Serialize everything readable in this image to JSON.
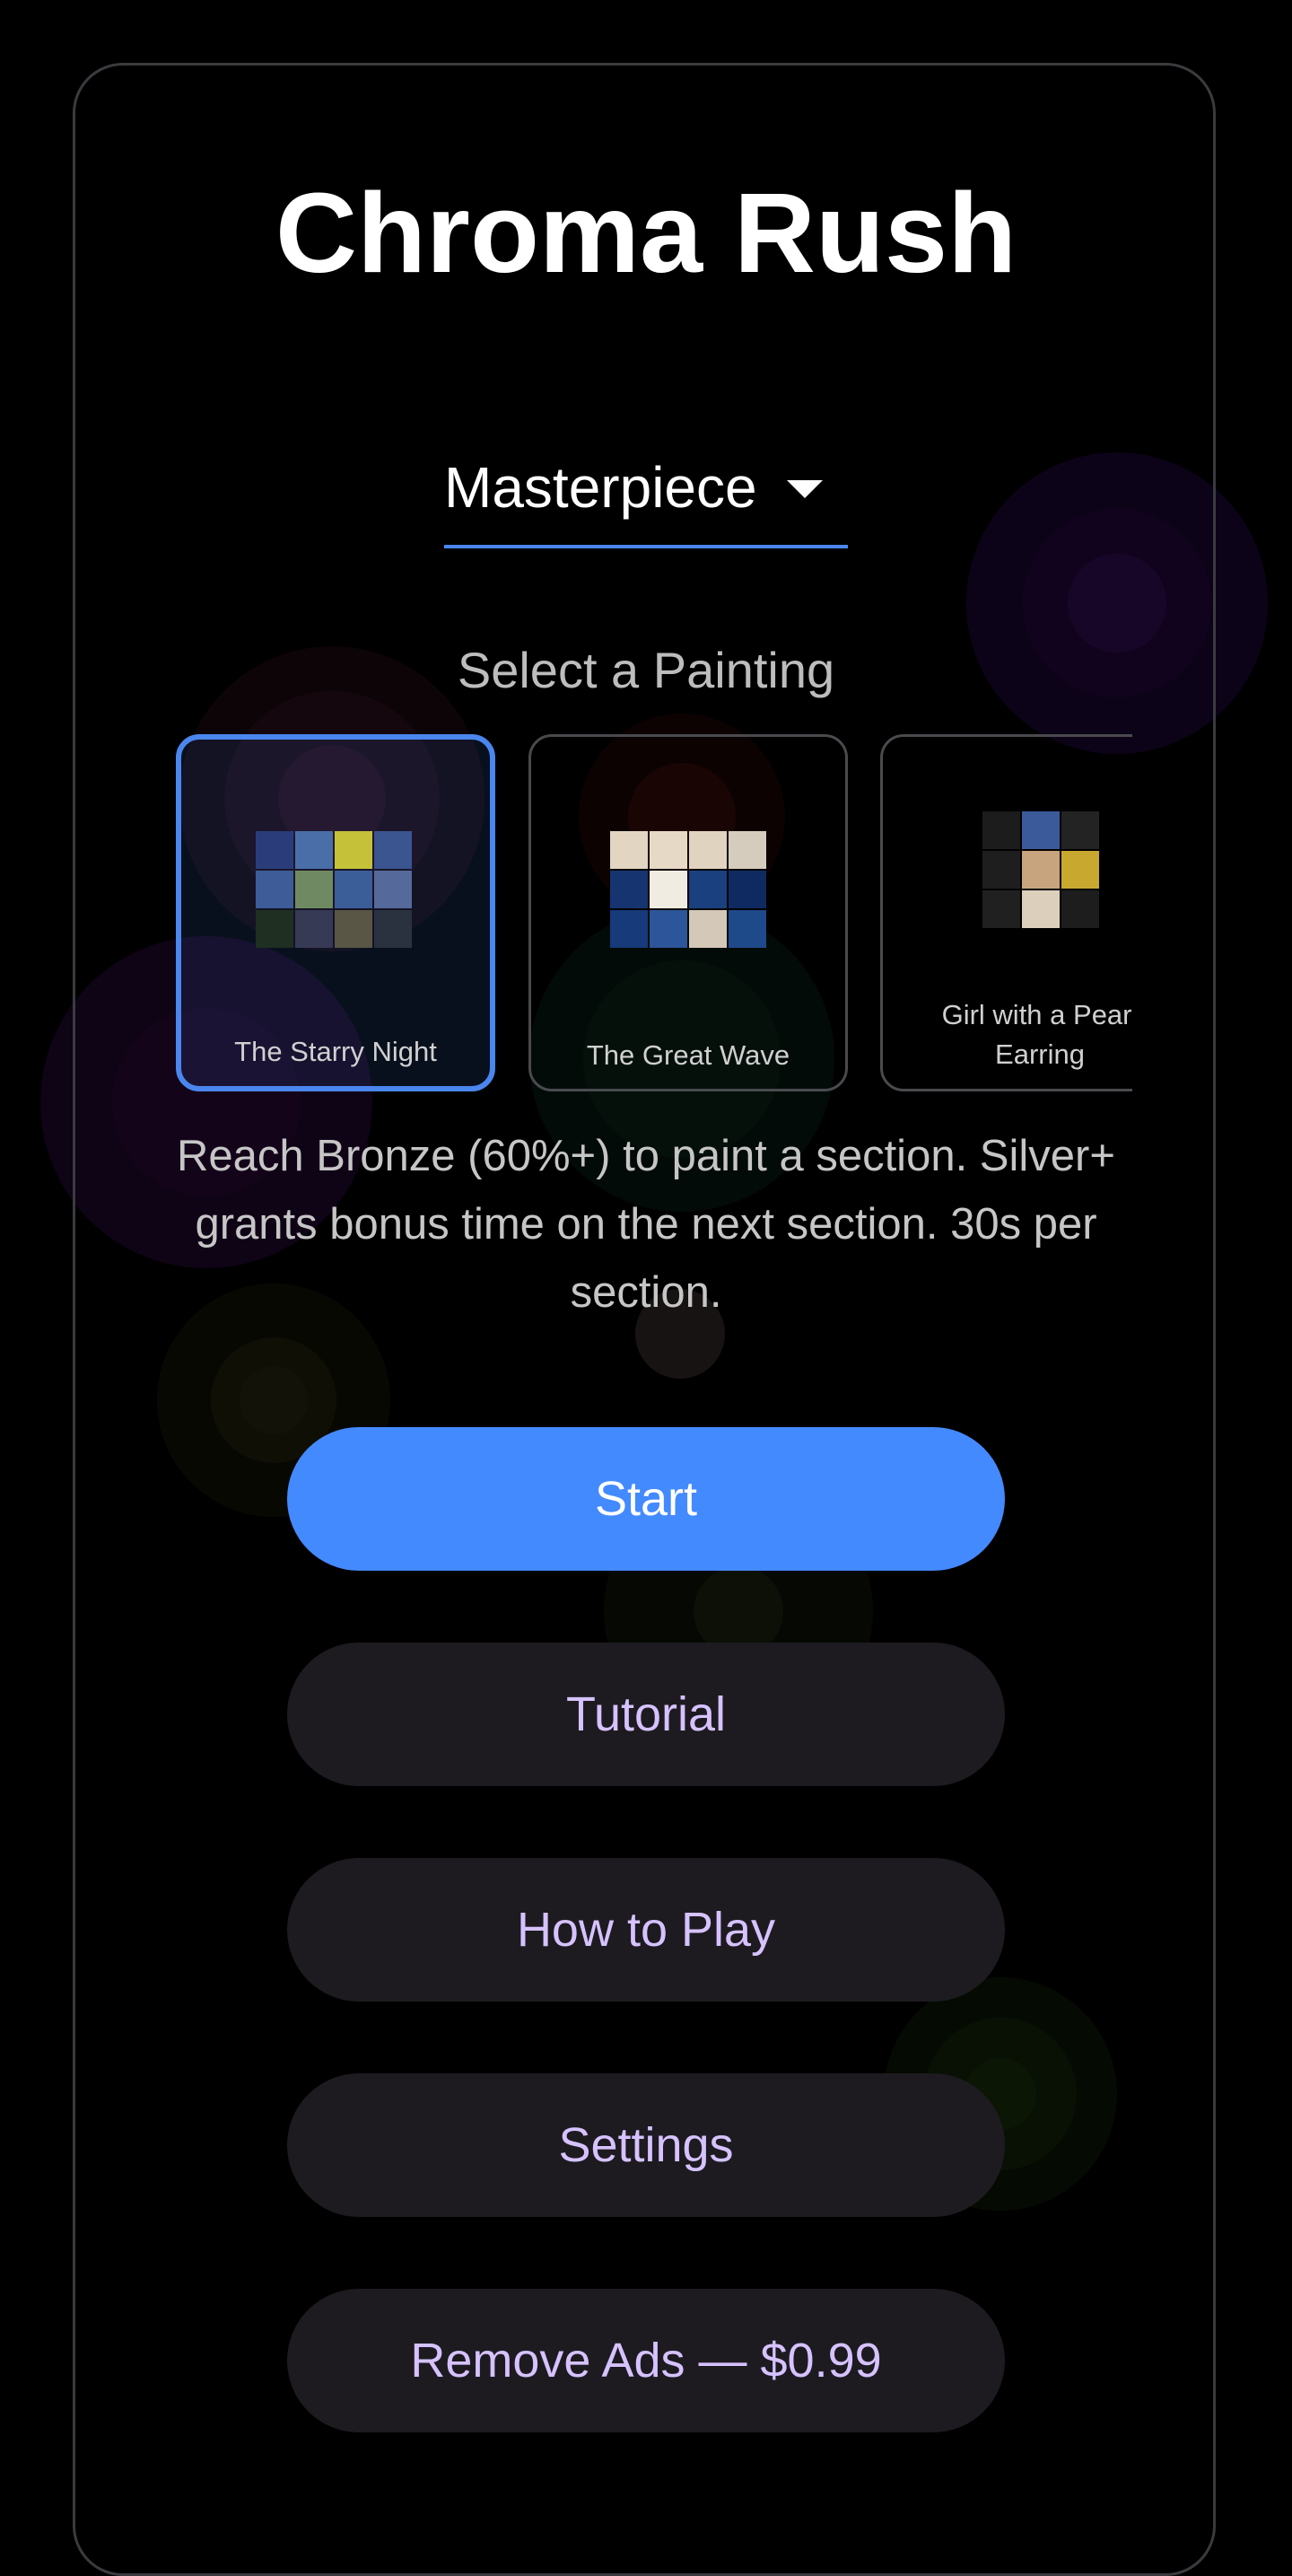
{
  "app": {
    "title": "Chroma Rush"
  },
  "mode_select": {
    "value": "Masterpiece",
    "icon": "caret-down-icon"
  },
  "paintings": {
    "label": "Select a Painting",
    "items": [
      {
        "name": "The Starry Night",
        "selected": true,
        "swatches": [
          "#2a3d7a",
          "#4a6fa8",
          "#c5c23a",
          "#3a5590",
          "#3d5c98",
          "#6f8a62",
          "#3b5d98",
          "#55699a",
          "#1f2f22",
          "#363a55",
          "#5a5645",
          "#2a3240"
        ]
      },
      {
        "name": "The Great Wave",
        "selected": false,
        "swatches": [
          "#e2d6c2",
          "#e6dac6",
          "#e0d4c0",
          "#d6ccbe",
          "#163570",
          "#f0ece2",
          "#1a4080",
          "#0f2a60",
          "#163a7a",
          "#2d5599",
          "#d4c8b8",
          "#1f4a8a"
        ]
      },
      {
        "name": "Girl with a Pearl\nEarring",
        "selected": false,
        "swatches": [
          "#1c1c1c",
          "#3a5a9a",
          "#232323",
          "#1e1e1e",
          "#c8a47e",
          "#c9a830",
          "#202020",
          "#dcd0bc",
          "#1d1d1d"
        ]
      }
    ]
  },
  "rules_text": "Reach Bronze (60%+) to paint a section. Silver+ grants bonus time on the next section. 30s per section.",
  "buttons": {
    "start": "Start",
    "tutorial": "Tutorial",
    "how_to_play": "How to Play",
    "settings": "Settings",
    "remove_ads": "Remove Ads — $0.99"
  },
  "colors": {
    "accent": "#448aff",
    "secondary_button_bg": "#1d1b20",
    "secondary_button_text": "#d6c2ff",
    "background": "#000000"
  }
}
